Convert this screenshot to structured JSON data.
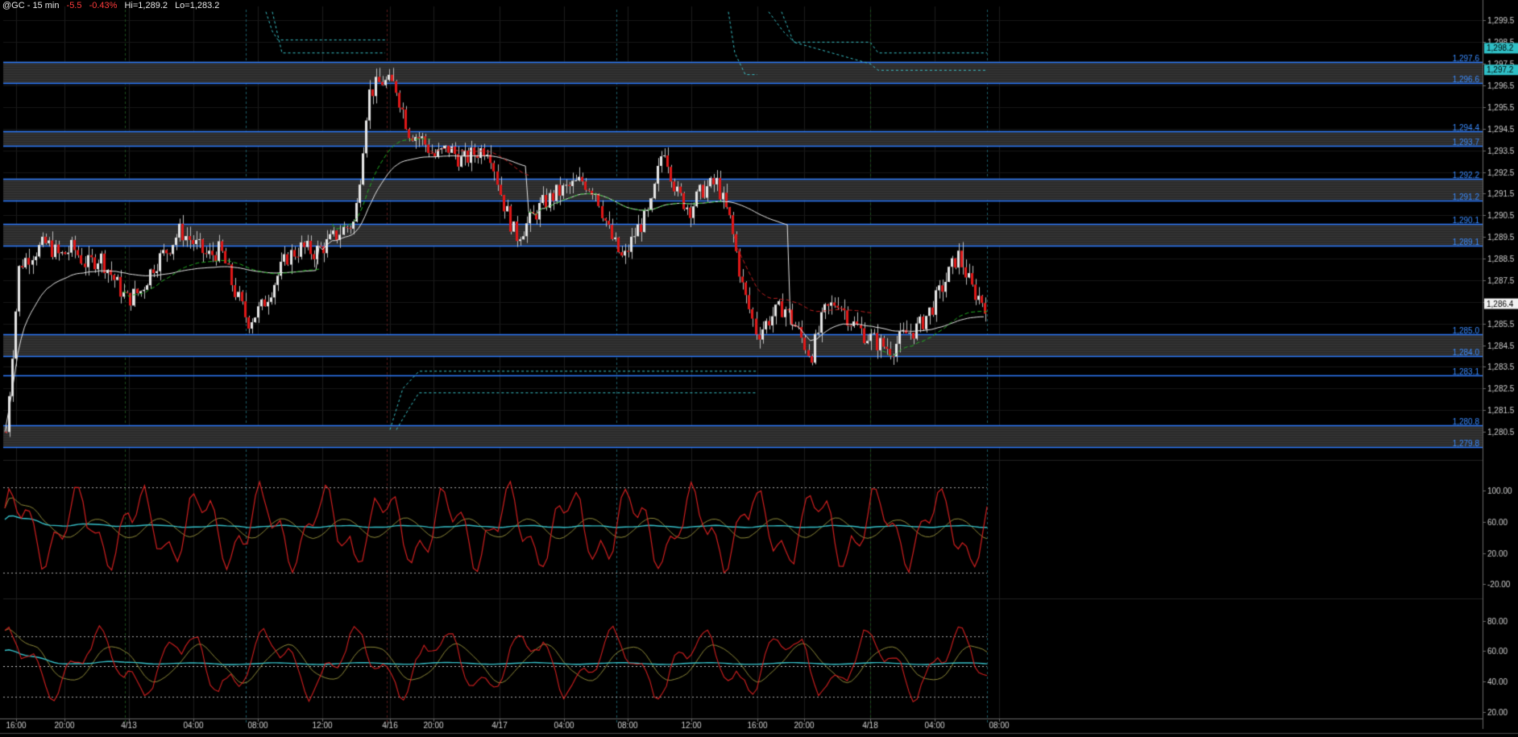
{
  "header": {
    "symbol": "@GC - 15 min",
    "change": "-5.5",
    "change_pct": "-0.43%",
    "hi": "Hi=1,289.2",
    "lo": "Lo=1,283.2"
  },
  "colors": {
    "background": "#000000",
    "up_candle": "#e6e6e6",
    "down_candle": "#e01818",
    "band_line": "#2f7dff",
    "band_fill": "#2a2a2a",
    "band_label": "#3b8cff",
    "cyan": "#3cc9cf",
    "green_dash": "#22b022",
    "red_dash": "#c22222",
    "osc_red": "#d42020",
    "osc_olive": "#8f8a3a",
    "osc_cyan": "#37c3cc"
  },
  "chart_data": [
    {
      "type": "candlestick",
      "name": "price",
      "x_ticks": [
        "16:00",
        "20:00",
        "4/13",
        "04:00",
        "08:00",
        "12:00",
        "4/16",
        "20:00",
        "4/17",
        "04:00",
        "08:00",
        "12:00",
        "16:00",
        "20:00",
        "4/18",
        "04:00",
        "08:00"
      ],
      "y_ticks": [
        "1,299.5",
        "1,298.5",
        "1,297.5",
        "1,296.5",
        "1,295.5",
        "1,294.5",
        "1,293.5",
        "1,292.5",
        "1,291.5",
        "1,290.5",
        "1,289.5",
        "1,288.5",
        "1,287.5",
        "1,286.5",
        "1,285.5",
        "1,284.5",
        "1,283.5",
        "1,282.5",
        "1,281.5",
        "1,280.5"
      ],
      "ylim": [
        1279.5,
        1300.0
      ],
      "last_price": "1,286.4",
      "price_badges": [
        "1,298.2",
        "1,297.2"
      ],
      "levels": [
        {
          "value": 1297.6,
          "label": "1,297.6"
        },
        {
          "value": 1296.6,
          "label": "1,296.6"
        },
        {
          "value": 1294.4,
          "label": "1,294.4"
        },
        {
          "value": 1293.7,
          "label": "1,293.7"
        },
        {
          "value": 1292.2,
          "label": "1,292.2"
        },
        {
          "value": 1291.2,
          "label": "1,291.2"
        },
        {
          "value": 1290.1,
          "label": "1,290.1"
        },
        {
          "value": 1289.1,
          "label": "1,289.1"
        },
        {
          "value": 1285.0,
          "label": "1,285.0"
        },
        {
          "value": 1284.0,
          "label": "1,284.0"
        },
        {
          "value": 1283.1,
          "label": "1,283.1"
        },
        {
          "value": 1280.8,
          "label": "1,280.8"
        },
        {
          "value": 1279.8,
          "label": "1,279.8"
        }
      ],
      "bands": [
        [
          1296.6,
          1297.6
        ],
        [
          1293.7,
          1294.4
        ],
        [
          1291.2,
          1292.2
        ],
        [
          1289.1,
          1290.1
        ],
        [
          1284.0,
          1285.0
        ],
        [
          1279.8,
          1280.8
        ]
      ],
      "close_path": [
        1280.5,
        1288.2,
        1288.8,
        1289.2,
        1288.6,
        1289.0,
        1288.2,
        1288.6,
        1287.6,
        1286.6,
        1287.0,
        1288.2,
        1288.9,
        1289.8,
        1289.2,
        1288.6,
        1288.9,
        1287.1,
        1285.6,
        1286.2,
        1287.4,
        1288.6,
        1289.0,
        1288.8,
        1289.2,
        1289.8,
        1290.2,
        1296.1,
        1296.7,
        1296.5,
        1294.4,
        1294.0,
        1293.2,
        1293.6,
        1293.0,
        1293.4,
        1293.7,
        1291.2,
        1289.5,
        1290.2,
        1291.0,
        1291.5,
        1291.8,
        1292.1,
        1291.6,
        1289.6,
        1288.4,
        1289.8,
        1290.6,
        1293.8,
        1291.5,
        1290.8,
        1291.7,
        1292.0,
        1290.2,
        1287.0,
        1285.0,
        1285.8,
        1286.3,
        1285.2,
        1284.0,
        1286.0,
        1286.6,
        1285.6,
        1285.0,
        1284.6,
        1284.3,
        1285.0,
        1285.3,
        1286.2,
        1287.4,
        1288.7,
        1287.1,
        1286.4
      ],
      "vertical_time_markers": [
        "4/13",
        "4/16",
        "4/17",
        "4/18"
      ]
    },
    {
      "type": "line",
      "name": "oscillator-1",
      "y_ticks": [
        "100.00",
        "60.00",
        "20.00",
        "-20.00"
      ],
      "ylim": [
        -30,
        120
      ],
      "levels": [
        105,
        -5
      ],
      "series_colors": [
        "#d42020",
        "#8f8a3a",
        "#37c3cc"
      ]
    },
    {
      "type": "line",
      "name": "oscillator-2",
      "y_ticks": [
        "80.00",
        "60.00",
        "40.00",
        "20.00"
      ],
      "ylim": [
        15,
        90
      ],
      "levels": [
        70,
        50,
        30
      ],
      "series_colors": [
        "#d42020",
        "#8f8a3a",
        "#37c3cc"
      ]
    }
  ]
}
